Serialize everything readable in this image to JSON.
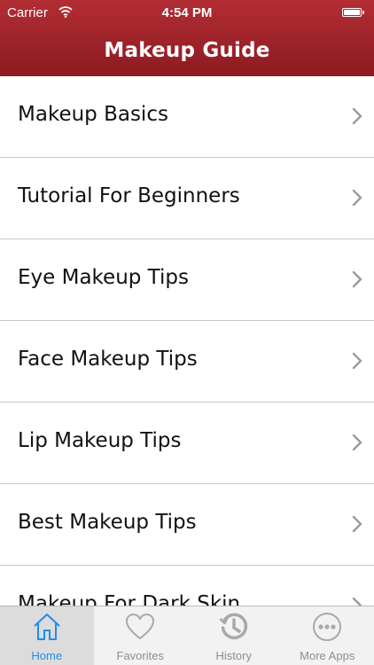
{
  "status_bar": {
    "carrier": "Carrier",
    "time": "4:54 PM"
  },
  "header": {
    "title": "Makeup Guide"
  },
  "list": {
    "items": [
      {
        "label": "Makeup Basics"
      },
      {
        "label": "Tutorial For Beginners"
      },
      {
        "label": "Eye Makeup Tips"
      },
      {
        "label": "Face Makeup Tips"
      },
      {
        "label": "Lip Makeup Tips"
      },
      {
        "label": "Best Makeup Tips"
      },
      {
        "label": "Makeup For Dark Skin"
      }
    ]
  },
  "tabbar": {
    "tabs": [
      {
        "label": "Home",
        "icon": "home-icon",
        "active": true
      },
      {
        "label": "Favorites",
        "icon": "heart-icon",
        "active": false
      },
      {
        "label": "History",
        "icon": "history-icon",
        "active": false
      },
      {
        "label": "More Apps",
        "icon": "more-icon",
        "active": false
      }
    ]
  },
  "colors": {
    "header": "#a3252c",
    "tab_active": "#1f8bf5",
    "tab_inactive": "#8e8e93"
  }
}
